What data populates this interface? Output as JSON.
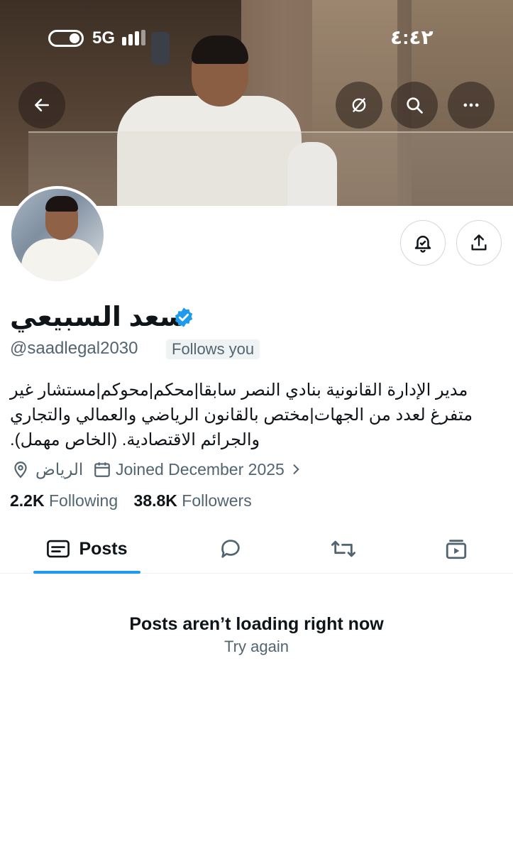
{
  "status_bar": {
    "network": "5G",
    "time": "٤:٤٢"
  },
  "profile": {
    "name": "سعد السبيعي",
    "handle": "@saadlegal2030",
    "follows_you": "Follows you",
    "bio": "مدير الإدارة القانونية بنادي النصر سابقا|محكم|محوكم|مستشار غير متفرغ لعدد من الجهات|مختص بالقانون الرياضي والعمالي والتجاري والجرائم الاقتصادية. (الخاص مهمل).",
    "location": "الرياض",
    "joined": "Joined December 2025",
    "following_count": "2.2K",
    "following_label": "Following",
    "followers_count": "38.8K",
    "followers_label": "Followers"
  },
  "tabs": [
    {
      "label": "Posts",
      "icon": "posts-icon",
      "active": true
    },
    {
      "label": "",
      "icon": "replies-icon"
    },
    {
      "label": "",
      "icon": "reposts-icon"
    },
    {
      "label": "",
      "icon": "media-icon"
    }
  ],
  "content": {
    "error_title": "Posts aren’t loading right now",
    "retry": "Try again"
  },
  "colors": {
    "accent": "#1d9bf0",
    "text": "#0f1419",
    "secondary": "#536471"
  }
}
